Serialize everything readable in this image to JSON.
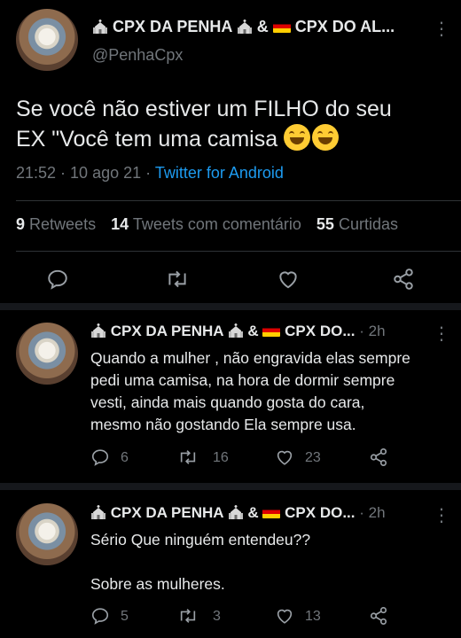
{
  "main_tweet": {
    "display_name": "CPX DA PENHA",
    "display_name_amp": "&",
    "display_name_2": "CPX DO AL...",
    "handle": "@PenhaCpx",
    "text_line1": "Se você não estiver um FILHO do seu",
    "text_line2": "EX \"Você tem uma camisa",
    "time": "21:52 · 10 ago 21 ·",
    "source": "Twitter for Android",
    "stats": {
      "retweets_count": "9",
      "retweets_label": "Retweets",
      "quotes_count": "14",
      "quotes_label": "Tweets com comentário",
      "likes_count": "55",
      "likes_label": "Curtidas"
    },
    "more": "⋮"
  },
  "replies": [
    {
      "display_name": "CPX DA PENHA",
      "display_name_amp": "&",
      "display_name_2": "CPX DO...",
      "time": "· 2h",
      "more": "⋮",
      "lines": [
        "Quando a mulher , não engravida elas sempre",
        "pedi uma camisa,  na hora de dormir sempre",
        "vesti, ainda mais quando gosta do cara,",
        "mesmo não gostando Ela sempre usa."
      ],
      "replies": "6",
      "retweets": "16",
      "likes": "23"
    },
    {
      "display_name": "CPX DA PENHA",
      "display_name_amp": "&",
      "display_name_2": "CPX DO...",
      "time": "· 2h",
      "more": "⋮",
      "lines": [
        "Sério Que ninguém entendeu??",
        "",
        "Sobre as mulheres."
      ],
      "replies": "5",
      "retweets": "3",
      "likes": "13"
    }
  ],
  "colors": {
    "background": "#000000",
    "text": "#e7e9ea",
    "muted": "#71767b",
    "link": "#1d9bf0"
  }
}
